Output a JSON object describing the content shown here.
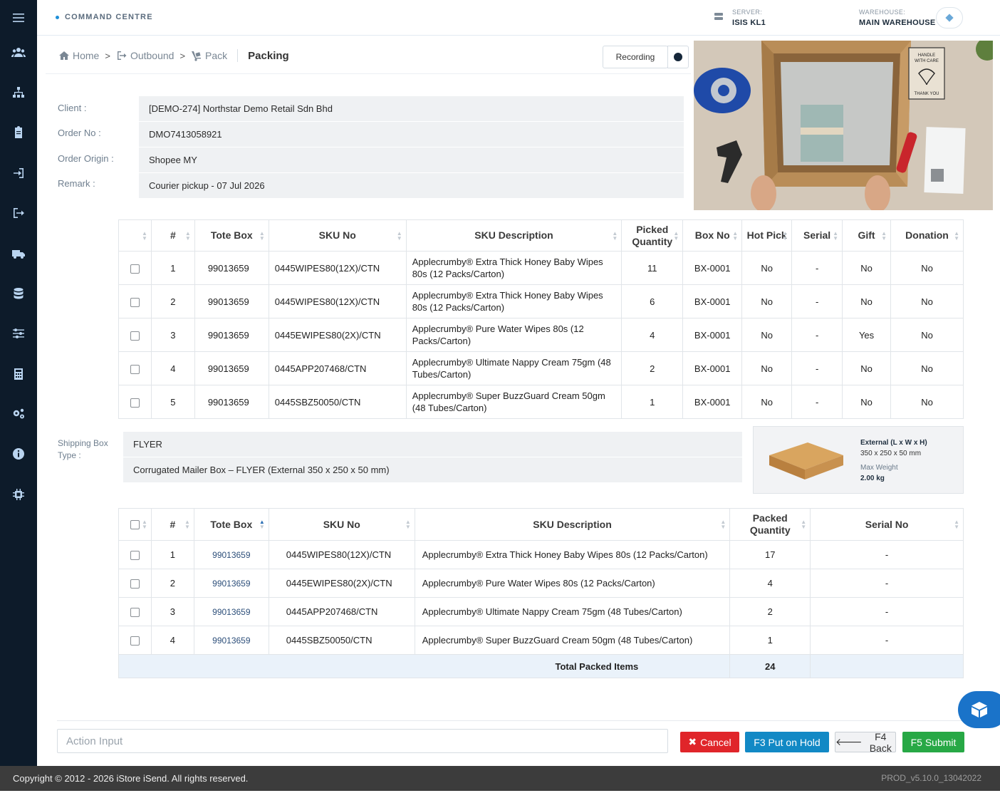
{
  "header": {
    "brand": "COMMAND CENTRE",
    "server_label": "SERVER:",
    "server_value": "ISIS KL1",
    "warehouse_label": "WAREHOUSE:",
    "warehouse_value": "MAIN WAREHOUSE"
  },
  "breadcrumb": {
    "home": "Home",
    "outbound": "Outbound",
    "pack": "Pack",
    "current": "Packing",
    "separator": ">"
  },
  "recording": {
    "label": "Recording"
  },
  "order": {
    "client_label": "Client :",
    "client_value": "[DEMO-274] Northstar Demo Retail Sdn Bhd",
    "order_no_label": "Order No :",
    "order_no_value": "DMO7413058921",
    "origin_label": "Order Origin :",
    "origin_value": "Shopee MY",
    "remark_label": "Remark :",
    "remark_value": "Courier pickup - 07 Jul 2026"
  },
  "pick_table": {
    "headers": [
      "#",
      "Tote Box",
      "SKU No",
      "SKU Description",
      "Picked Quantity",
      "Box No",
      "Hot Pick",
      "Serial",
      "Gift",
      "Donation"
    ],
    "rows": [
      {
        "n": "1",
        "tote": "99013659",
        "sku": "0445WIPES80(12X)/CTN",
        "desc": "Applecrumby® Extra Thick Honey Baby Wipes 80s (12 Packs/Carton)",
        "qty": "11",
        "box": "BX-0001",
        "hot": "No",
        "serial": "-",
        "gift": "No",
        "donation": "No"
      },
      {
        "n": "2",
        "tote": "99013659",
        "sku": "0445WIPES80(12X)/CTN",
        "desc": "Applecrumby® Extra Thick Honey Baby Wipes 80s (12 Packs/Carton)",
        "qty": "6",
        "box": "BX-0001",
        "hot": "No",
        "serial": "-",
        "gift": "No",
        "donation": "No"
      },
      {
        "n": "3",
        "tote": "99013659",
        "sku": "0445EWIPES80(2X)/CTN",
        "desc": "Applecrumby® Pure Water Wipes 80s (12 Packs/Carton)",
        "qty": "4",
        "box": "BX-0001",
        "hot": "No",
        "serial": "-",
        "gift": "Yes",
        "donation": "No"
      },
      {
        "n": "4",
        "tote": "99013659",
        "sku": "0445APP207468/CTN",
        "desc": "Applecrumby® Ultimate Nappy Cream 75gm (48 Tubes/Carton)",
        "qty": "2",
        "box": "BX-0001",
        "hot": "No",
        "serial": "-",
        "gift": "No",
        "donation": "No"
      },
      {
        "n": "5",
        "tote": "99013659",
        "sku": "0445SBZ50050/CTN",
        "desc": "Applecrumby® Super BuzzGuard Cream 50gm (48 Tubes/Carton)",
        "qty": "1",
        "box": "BX-0001",
        "hot": "No",
        "serial": "-",
        "gift": "No",
        "donation": "No"
      }
    ]
  },
  "shipping": {
    "label": "Shipping Box Type :",
    "type": "FLYER",
    "description": "Corrugated Mailer Box – FLYER (External 350 x 250 x 50 mm)",
    "ext_label": "External (L x W x H)",
    "ext_value": "350 x 250 x 50 mm",
    "weight_label": "Max Weight",
    "weight_value": "2.00 kg"
  },
  "packed_table": {
    "headers": [
      "#",
      "Tote Box",
      "SKU No",
      "SKU Description",
      "Packed Quantity",
      "Serial No"
    ],
    "rows": [
      {
        "n": "1",
        "tote": "99013659",
        "sku": "0445WIPES80(12X)/CTN",
        "desc": "Applecrumby® Extra Thick Honey Baby Wipes 80s (12 Packs/Carton)",
        "qty": "17",
        "serial": "-"
      },
      {
        "n": "2",
        "tote": "99013659",
        "sku": "0445EWIPES80(2X)/CTN",
        "desc": "Applecrumby® Pure Water Wipes 80s (12 Packs/Carton)",
        "qty": "4",
        "serial": "-"
      },
      {
        "n": "3",
        "tote": "99013659",
        "sku": "0445APP207468/CTN",
        "desc": "Applecrumby® Ultimate Nappy Cream 75gm (48 Tubes/Carton)",
        "qty": "2",
        "serial": "-"
      },
      {
        "n": "4",
        "tote": "99013659",
        "sku": "0445SBZ50050/CTN",
        "desc": "Applecrumby® Super BuzzGuard Cream 50gm (48 Tubes/Carton)",
        "qty": "1",
        "serial": "-"
      }
    ],
    "total_label": "Total Packed Items",
    "total_value": "24"
  },
  "actions": {
    "input_placeholder": "Action Input",
    "cancel": "Cancel",
    "hold": "F3 Put on Hold",
    "back": "F4 Back",
    "submit": "F5 Submit"
  },
  "camera_overlay": {
    "sign_line1": "HANDLE",
    "sign_line2": "WITH CARE",
    "sign_line3": "THANK YOU"
  },
  "footer": {
    "copyright": "Copyright © 2012 - 2026 iStore iSend. All rights reserved.",
    "version": "PROD_v5.10.0_13042022"
  },
  "colors": {
    "sidebar": "#0d1b2a",
    "cancel": "#e0252a",
    "hold": "#1289c5",
    "submit": "#27a845",
    "footer": "#3c3c3c"
  }
}
